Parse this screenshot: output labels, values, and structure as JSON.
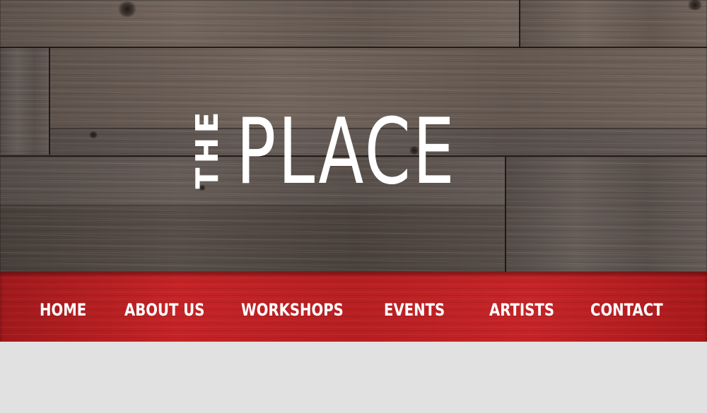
{
  "logo": {
    "small_word": "THE",
    "big_word": "PLACE"
  },
  "nav": {
    "items": [
      {
        "label": "HOME"
      },
      {
        "label": "ABOUT US"
      },
      {
        "label": "WORKSHOPS"
      },
      {
        "label": "EVENTS"
      },
      {
        "label": "ARTISTS"
      },
      {
        "label": "CONTACT"
      }
    ]
  },
  "colors": {
    "nav_red": "#b51e21",
    "wood": "#5e524b",
    "content_bg": "#e1e1e1",
    "text": "#ffffff"
  }
}
